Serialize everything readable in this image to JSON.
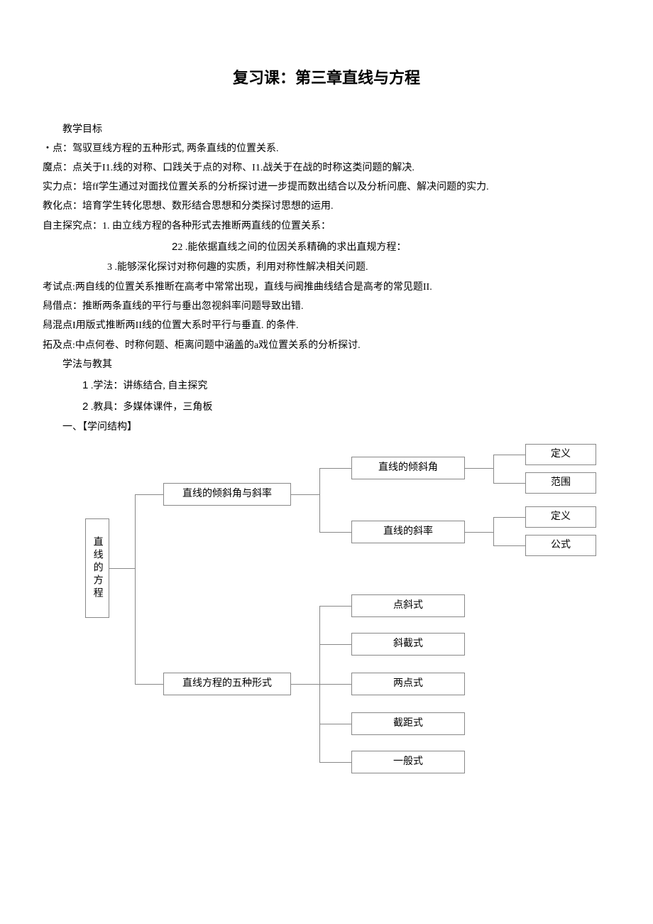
{
  "title": "复习课：第三章直线与方程",
  "heading_goal": "教学目标",
  "lines": {
    "l1": "・点：驾驭亘线方程的五种形式, 两条直线的位置关系.",
    "l2": "魔点：点关于I1.线的对称、口践关于点的对称、I1.战关于在战的时称这类问题的解决.",
    "l3": "实力点：培ff学生通过对面找位置关系的分析探讨进一步提而数出结合以及分析问鹿、解决问题的实力.",
    "l4": "教化点：培育学生转化思想、数形结合思想和分类探讨思想的运用.",
    "l5": "自主探究点：1. 由立线方程的各种形式去推断两直线的位置关系：",
    "l6": "2 .能依据直线之间的位因关系精确的求出直规方程：",
    "l7": "3 .能够深化探讨对称何趣的实质，利用对称性解决相关问题.",
    "l8": "考试点:两自线的位置关系推断在高考中常常出现，直线与阀推曲线结合是高考的常见题II.",
    "l9": "舄借点：推断两条直线的平行与垂出忽视斜率问题导致出错.",
    "l10": "舄混点I用版式推断两II线的位置大系时平行与垂直. 的条件.",
    "l11": "拓及点:中点何卷、时称何题、柜离问题中涵盖的a戏位置关系的分析探讨."
  },
  "heading_method": "学法与教其",
  "item1_num": "1",
  "item1_txt": " .学法：讲练结合, 自主探究",
  "item2_num": "2",
  "item2_txt": " .教具：多媒体课件，三角板",
  "section_one": "一、【学问结构】",
  "diagram": {
    "root": "直线的方程",
    "b1": "直线的倾斜角与斜率",
    "b2": "直线方程的五种形式",
    "b1c1": "直线的倾斜角",
    "b1c2": "直线的斜率",
    "leaf_def1": "定义",
    "leaf_range": "范围",
    "leaf_def2": "定义",
    "leaf_formula": "公式",
    "form1": "点斜式",
    "form2": "斜截式",
    "form3": "两点式",
    "form4": "截距式",
    "form5": "一般式"
  }
}
